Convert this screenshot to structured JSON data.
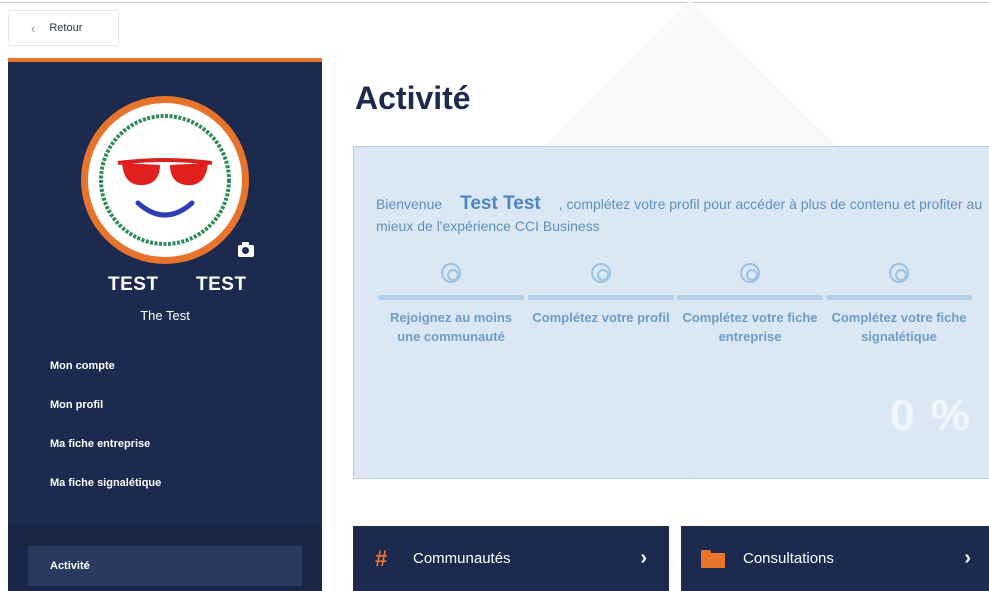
{
  "back": {
    "label": "Retour",
    "icon": "chevron-left-icon"
  },
  "user": {
    "first_name": "TEST",
    "last_name": "TEST",
    "company": "The Test"
  },
  "sidebar": {
    "menu": [
      {
        "label": "Mon compte"
      },
      {
        "label": "Mon profil"
      },
      {
        "label": "Ma fiche entreprise"
      },
      {
        "label": "Ma fiche signalétique"
      }
    ],
    "active_item": "Activité"
  },
  "main": {
    "title": "Activité",
    "welcome_prefix": "Bienvenue",
    "welcome_name": "Test Test",
    "welcome_suffix": ", complétez votre profil pour accéder à plus de contenu et profiter au mieux de l'expérience CCI Business",
    "steps": [
      {
        "label": "Rejoignez au moins une communauté"
      },
      {
        "label": "Complétez votre profil"
      },
      {
        "label": "Complétez votre fiche entreprise"
      },
      {
        "label": "Complétez votre fiche signalétique"
      }
    ],
    "progress_percent": "0 %",
    "tiles": [
      {
        "label": "Communautés",
        "icon": "hashtag-icon"
      },
      {
        "label": "Consultations",
        "icon": "folder-icon"
      }
    ]
  },
  "colors": {
    "navy": "#1c2a4f",
    "accent": "#e8742b",
    "card_bg": "#dbe8f4",
    "card_text": "#5f8fbd"
  }
}
